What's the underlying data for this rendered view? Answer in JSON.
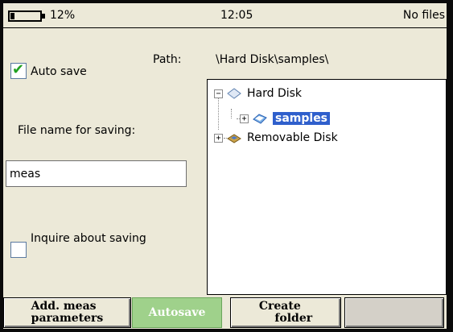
{
  "status": {
    "battery_text": "12%",
    "battery_level": 0.12,
    "time": "12:05",
    "file_status": "No files"
  },
  "left": {
    "auto_save_label": "Auto save",
    "auto_save_checked": true,
    "file_name_label": "File name for saving:",
    "file_name_value": "meas",
    "inquire_label": "Inquire about saving",
    "inquire_checked": false
  },
  "path": {
    "label": "Path:",
    "value": "\\Hard Disk\\samples\\"
  },
  "tree": {
    "nodes": [
      {
        "label": "Hard Disk",
        "expander": "−",
        "icon": "hard-disk-icon"
      },
      {
        "label": "samples",
        "expander": "+",
        "icon": "folder-icon",
        "selected": true
      },
      {
        "label": "Removable Disk",
        "expander": "+",
        "icon": "removable-disk-icon"
      }
    ]
  },
  "buttons": {
    "add_meas": "Add. meas\nparameters",
    "autosave": "Autosave",
    "create_folder": "Create\n    folder",
    "empty": ""
  },
  "colors": {
    "screen_bg": "#ece9d8",
    "selection": "#2f5fcc",
    "autosave_active": "#9fd18b",
    "check": "#21a121"
  }
}
